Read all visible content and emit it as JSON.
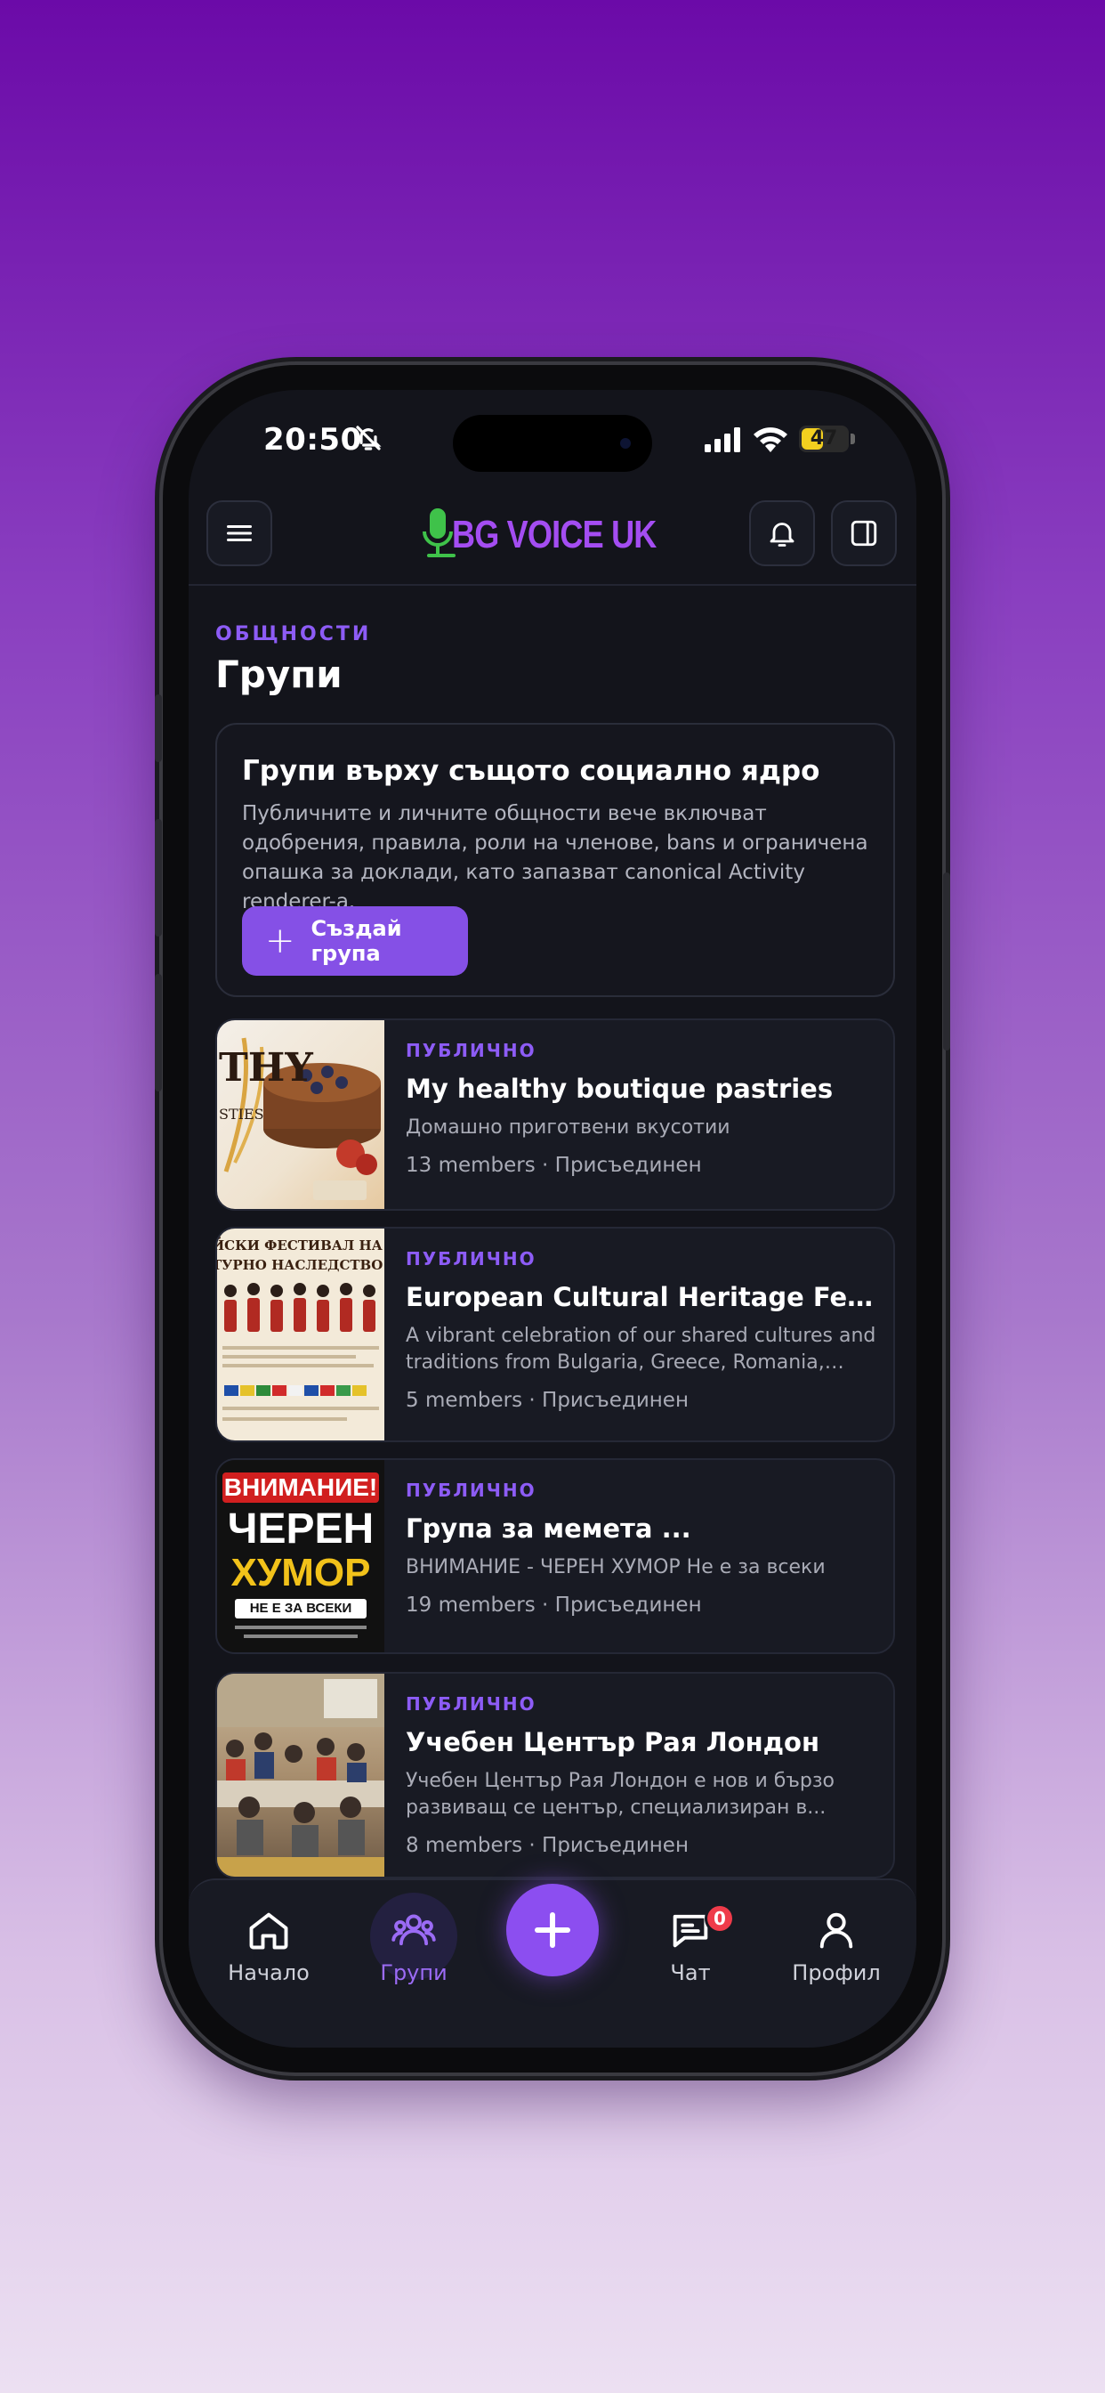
{
  "status_bar": {
    "time": "20:50",
    "battery": "47",
    "battery_level": 0.47
  },
  "header": {
    "logo_text": "BG VOICE UK"
  },
  "page": {
    "eyebrow": "ОБЩНОСТИ",
    "title": "Групи"
  },
  "info_card": {
    "title": "Групи върху същото социално ядро",
    "body": "Публичните и личните общности вече включват одобрения, правила, роли на членове, bans и ограничена опашка за доклади, като запазват canonical Activity renderer-a.",
    "button_label": "Създай група"
  },
  "groups": [
    {
      "visibility": "ПУБЛИЧНО",
      "name": "My healthy boutique pastries",
      "description": "Домашно приготвени вкусотии",
      "meta": "13 members · Присъединен"
    },
    {
      "visibility": "ПУБЛИЧНО",
      "name": "European Cultural Heritage Festival",
      "description": "A vibrant celebration of our shared cultures and traditions from Bulgaria, Greece, Romania, Hungary,...",
      "meta": "5 members · Присъединен"
    },
    {
      "visibility": "ПУБЛИЧНО",
      "name": "Група за мемета ...",
      "description": "ВНИМАНИЕ - ЧЕРЕН ХУМОР Не е за всеки",
      "meta": "19 members · Присъединен"
    },
    {
      "visibility": "ПУБЛИЧНО",
      "name": "Учебен Център Рая Лондон",
      "description": "Учебен Център Рая Лондон е нов и бързо развиващ се център, специализиран в...",
      "meta": "8 members · Присъединен"
    }
  ],
  "thumbnails": {
    "pastries": {
      "text": "THY",
      "sub": "STIES"
    },
    "festival": {
      "line1": "ЙСКИ ФЕСТИВАЛ НА",
      "line2": "ТУРНО НАСЛЕДСТВО"
    },
    "memes": {
      "line1": "ВНИМАНИЕ!",
      "line2": "ЧЕРЕН",
      "line3": "ХУМОР",
      "line4": "НЕ Е ЗА ВСЕКИ"
    }
  },
  "nav": {
    "items": [
      {
        "label": "Начало",
        "icon": "home-icon"
      },
      {
        "label": "Групи",
        "icon": "users-icon"
      },
      {
        "label": "",
        "icon": "plus-icon"
      },
      {
        "label": "Чат",
        "icon": "chat-icon"
      },
      {
        "label": "Профил",
        "icon": "user-icon"
      }
    ],
    "chat_badge": "0"
  },
  "colors": {
    "accent": "#8d5cf6",
    "background": "#13141b",
    "badge": "#ef3b4a",
    "logo_mic": "#3fc24a"
  }
}
